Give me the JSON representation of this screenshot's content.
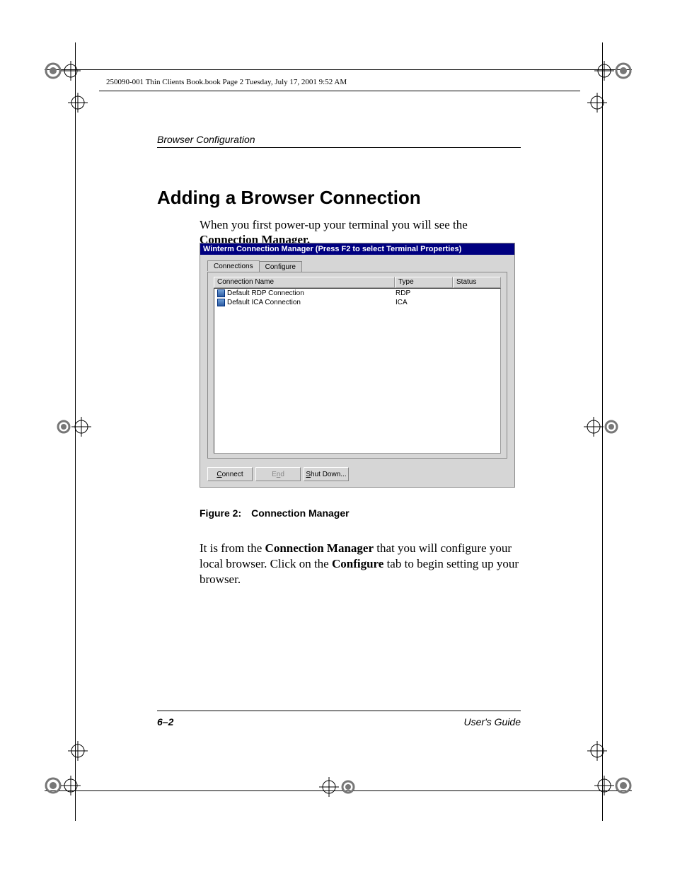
{
  "doc_info_line": "250090-001 Thin Clients Book.book  Page 2  Tuesday, July 17, 2001  9:52 AM",
  "running_head": "Browser Configuration",
  "heading": "Adding a Browser Connection",
  "para1_a": "When you first power-up your terminal you will see the ",
  "para1_b": "Connection Manager.",
  "window": {
    "title": "Winterm Connection Manager (Press F2 to select Terminal Properties)",
    "tabs": {
      "connections": "Connections",
      "configure": "Configure"
    },
    "columns": {
      "name": "Connection Name",
      "type": "Type",
      "status": "Status"
    },
    "rows": [
      {
        "name": "Default RDP Connection",
        "type": "RDP",
        "status": ""
      },
      {
        "name": "Default ICA Connection",
        "type": "ICA",
        "status": ""
      }
    ],
    "buttons": {
      "connect_u": "C",
      "connect_rest": "onnect",
      "end_pre": "E",
      "end_mid": "n",
      "end_post": "d",
      "shutdown_u": "S",
      "shutdown_rest": "hut Down..."
    }
  },
  "figure_caption_label": "Figure 2:",
  "figure_caption_text": "Connection Manager",
  "para2_a": "It is from the ",
  "para2_b": "Connection Manager",
  "para2_c": " that you will configure your local browser. Click on the ",
  "para2_d": "Configure",
  "para2_e": " tab to begin setting up your browser.",
  "page_number": "6–2",
  "guide_label": "User's Guide"
}
